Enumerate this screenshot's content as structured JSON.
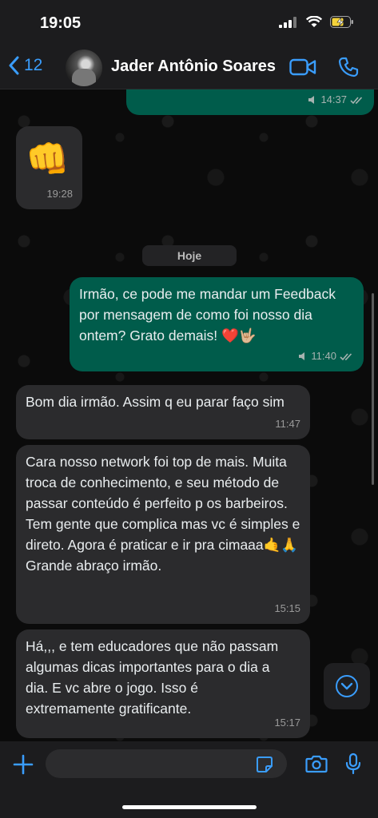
{
  "status_bar": {
    "time": "19:05"
  },
  "header": {
    "back_count": "12",
    "contact_name": "Jader Antônio Soares"
  },
  "messages": [
    {
      "id": "m0",
      "direction": "out",
      "text": "",
      "time": "14:37",
      "read": true
    },
    {
      "id": "m1",
      "direction": "in",
      "emoji": "👊",
      "time": "19:28"
    },
    {
      "id": "m2",
      "direction": "out",
      "text": "Irmão, ce pode me mandar um Feedback por mensagem de como foi nosso dia ontem? Grato demais! ❤️🤟🏼",
      "time": "11:40",
      "read": true
    },
    {
      "id": "m3",
      "direction": "in",
      "text": "Bom dia irmão. Assim q eu parar faço sim",
      "time": "11:47"
    },
    {
      "id": "m4",
      "direction": "in",
      "text": "Cara nosso network foi top de mais. Muita troca de conhecimento, e seu método de passar conteúdo é perfeito p os barbeiros. Tem gente que complica mas vc é simples e direto. Agora é praticar e ir pra cimaaa🤙🙏",
      "text2": "Grande abraço irmão.",
      "time": "15:15"
    },
    {
      "id": "m5",
      "direction": "in",
      "text": "Há,,, e tem educadores que não passam algumas dicas importantes para o dia a dia. E vc abre o jogo. Isso é extremamente gratificante.",
      "time": "15:17"
    }
  ],
  "day_separator": "Hoje",
  "input": {
    "placeholder": "",
    "value": ""
  },
  "colors": {
    "accent": "#3a9dfc",
    "outgoing_bubble": "#005c4b",
    "incoming_bubble": "#2b2b2d",
    "header_bg": "#1c1c1e"
  },
  "icons": {
    "back": "chevron-left-icon",
    "video": "video-camera-icon",
    "call": "phone-icon",
    "add": "plus-icon",
    "sticker": "sticker-icon",
    "camera": "camera-icon",
    "mic": "microphone-icon",
    "scroll_down": "chevron-down-circle-icon",
    "read_receipt": "double-check-icon",
    "audio": "speaker-icon"
  }
}
